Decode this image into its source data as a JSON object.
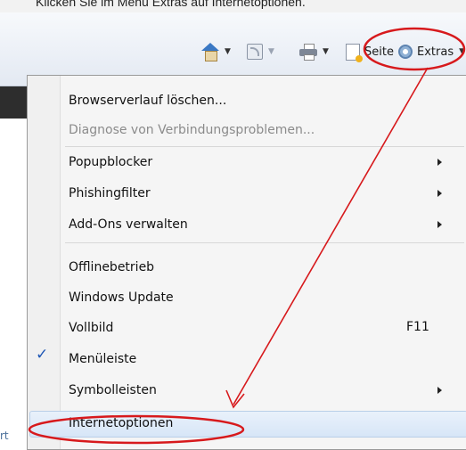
{
  "instruction": {
    "text": "Klicken Sie im Menü Extras auf Internetoptionen."
  },
  "toolbar": {
    "home_icon": "home-icon",
    "feeds_icon": "rss-feed-icon",
    "print_icon": "printer-icon",
    "page_label": "Seite",
    "tools_label": "Extras",
    "tools_icon": "gear-icon"
  },
  "left_fragment": "rt",
  "menu": {
    "items": [
      {
        "label": "Browserverlauf löschen...",
        "disabled": false
      },
      {
        "label": "Diagnose von Verbindungsproblemen...",
        "disabled": true
      },
      {
        "label": "Popupblocker",
        "submenu": true
      },
      {
        "label": "Phishingfilter",
        "submenu": true
      },
      {
        "label": "Add-Ons verwalten",
        "submenu": true
      },
      {
        "label": "Offlinebetrieb"
      },
      {
        "label": "Windows Update"
      },
      {
        "label": "Vollbild",
        "shortcut": "F11"
      },
      {
        "label": "Menüleiste",
        "checked": true
      },
      {
        "label": "Symbolleisten",
        "submenu": true
      },
      {
        "label": "Internetoptionen",
        "highlighted": true
      }
    ]
  },
  "colors": {
    "annotation_red": "#d7191c",
    "checkmark_blue": "#1f57b5",
    "menu_background": "#f5f5f5"
  }
}
